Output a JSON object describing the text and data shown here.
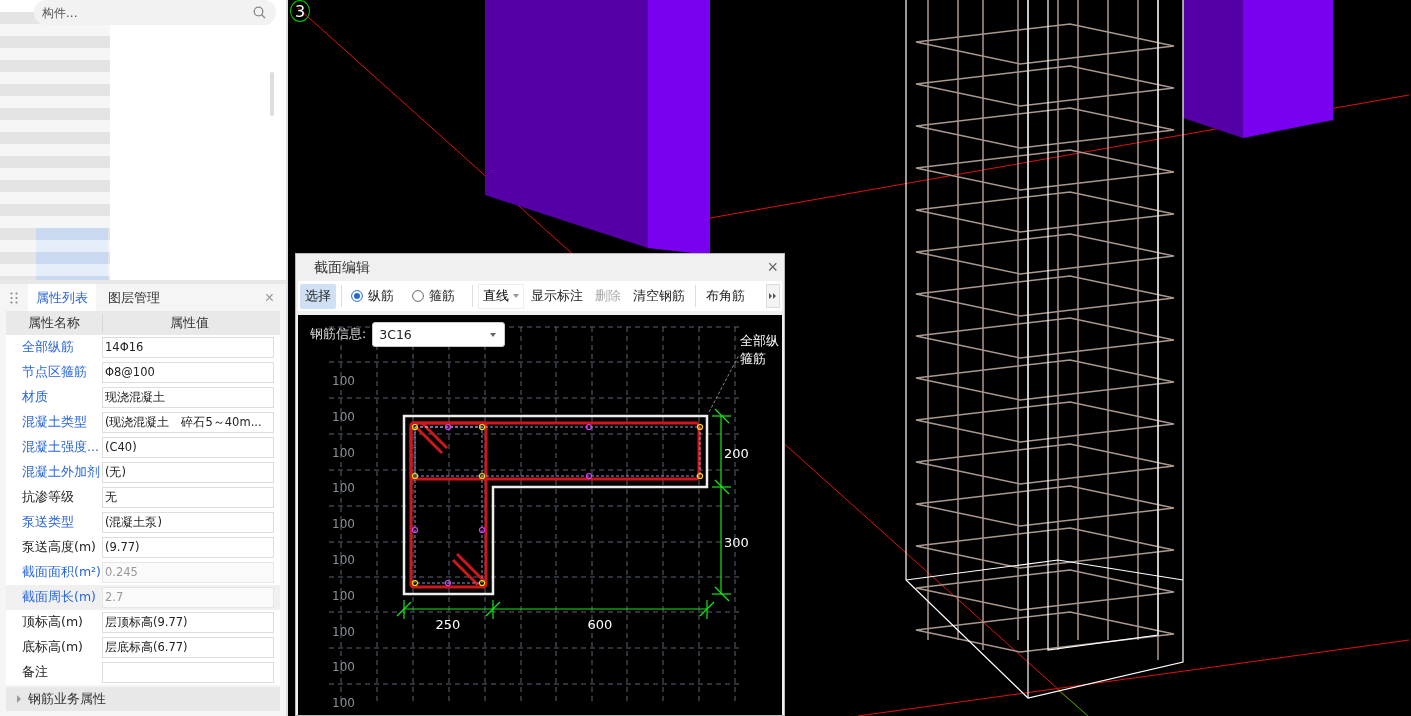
{
  "search": {
    "placeholder": "构件..."
  },
  "properties_panel": {
    "tabs": [
      {
        "label": "属性列表",
        "selected": true
      },
      {
        "label": "图层管理",
        "selected": false
      }
    ],
    "close": "×",
    "columns": [
      "属性名称",
      "属性值"
    ],
    "rows": [
      {
        "name": "全部纵筋",
        "value": "14Φ16",
        "link": true,
        "readonly": false,
        "selected": false
      },
      {
        "name": "节点区箍筋",
        "value": "Φ8@100",
        "link": true,
        "readonly": false,
        "selected": false
      },
      {
        "name": "材质",
        "value": "现浇混凝土",
        "link": true,
        "readonly": false,
        "selected": false
      },
      {
        "name": "混凝土类型",
        "value": "(现浇混凝土　碎石5～40m...",
        "link": true,
        "readonly": false,
        "selected": false
      },
      {
        "name": "混凝土强度...",
        "value": "(C40)",
        "link": true,
        "readonly": false,
        "selected": false
      },
      {
        "name": "混凝土外加剂",
        "value": "(无)",
        "link": true,
        "readonly": false,
        "selected": false
      },
      {
        "name": "抗渗等级",
        "value": "无",
        "link": false,
        "readonly": false,
        "selected": false
      },
      {
        "name": "泵送类型",
        "value": "(混凝土泵)",
        "link": true,
        "readonly": false,
        "selected": false
      },
      {
        "name": "泵送高度(m)",
        "value": "(9.77)",
        "link": false,
        "readonly": false,
        "selected": false
      },
      {
        "name": "截面面积(m²)",
        "value": "0.245",
        "link": true,
        "readonly": true,
        "selected": false
      },
      {
        "name": "截面周长(m)",
        "value": "2.7",
        "link": true,
        "readonly": true,
        "selected": true
      },
      {
        "name": "顶标高(m)",
        "value": "层顶标高(9.77)",
        "link": false,
        "readonly": false,
        "selected": false
      },
      {
        "name": "底标高(m)",
        "value": "层底标高(6.77)",
        "link": false,
        "readonly": false,
        "selected": false
      },
      {
        "name": "备注",
        "value": "",
        "link": false,
        "selected": false
      }
    ],
    "groups": [
      {
        "label": "钢筋业务属性",
        "expanded": false
      }
    ]
  },
  "viewport": {
    "axis_label": "3"
  },
  "dialog": {
    "title": "截面编辑",
    "close": "×",
    "toolbar": [
      {
        "kind": "button",
        "label": "选择",
        "selected": true,
        "disabled": false
      },
      {
        "kind": "separator"
      },
      {
        "kind": "radio",
        "label": "纵筋",
        "checked": true
      },
      {
        "kind": "radio",
        "label": "箍筋",
        "checked": false
      },
      {
        "kind": "separator"
      },
      {
        "kind": "dropdown",
        "label": "直线"
      },
      {
        "kind": "button",
        "label": "显示标注",
        "selected": false,
        "disabled": false
      },
      {
        "kind": "button",
        "label": "删除",
        "selected": false,
        "disabled": true
      },
      {
        "kind": "button",
        "label": "清空钢筋",
        "selected": false,
        "disabled": false
      },
      {
        "kind": "separator"
      },
      {
        "kind": "button",
        "label": "布角筋",
        "selected": false,
        "disabled": false
      },
      {
        "kind": "more"
      }
    ],
    "rebar_info": {
      "label": "钢筋信息:",
      "value": "3C16"
    },
    "canvas": {
      "grid_labels": [
        "100",
        "100",
        "100",
        "100",
        "100",
        "100",
        "100",
        "100",
        "100",
        "100"
      ],
      "width_dims": [
        "250",
        "600"
      ],
      "height_dims": [
        "200",
        "300"
      ],
      "annotation": [
        "全部纵",
        "箍筋"
      ]
    }
  }
}
